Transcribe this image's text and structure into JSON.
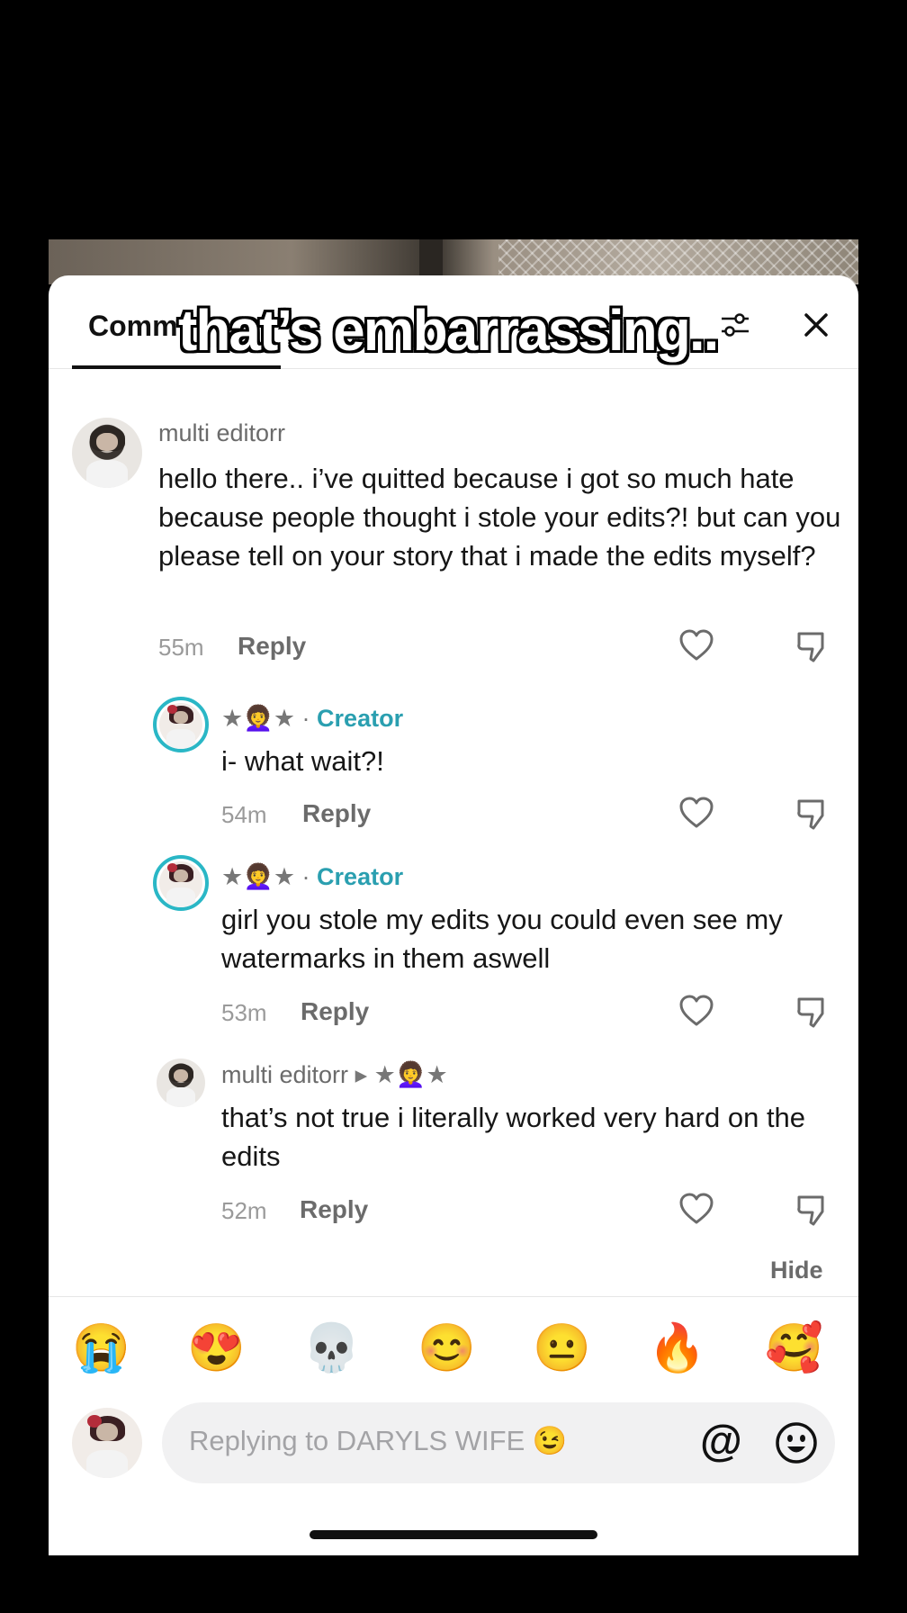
{
  "video": {
    "overlay_caption": "that’s embarrassing.."
  },
  "header": {
    "tab_label": "Comm"
  },
  "comments": [
    {
      "username": "multi editorr",
      "text": "hello there.. i’ve quitted because i got so much hate because people thought i stole your edits?! but can you please tell on your story that i made the edits myself?",
      "time": "55m",
      "reply_label": "Reply"
    },
    {
      "username_stars": "★👩‍🦱★ ·",
      "creator_tag": "Creator",
      "text": "i- what wait?!",
      "time": "54m",
      "reply_label": "Reply"
    },
    {
      "username_stars": "★👩‍🦱★ ·",
      "creator_tag": "Creator",
      "text": "girl you stole my edits you could even see my watermarks in them aswell",
      "time": "53m",
      "reply_label": "Reply"
    },
    {
      "username": "multi editorr",
      "reply_to": "▸ ★👩‍🦱★",
      "text": "that’s not true i literally worked very hard on the edits",
      "time": "52m",
      "reply_label": "Reply"
    }
  ],
  "hide_label": "Hide",
  "emoji_bar": [
    "😭",
    "😍",
    "💀",
    "😊",
    "😐",
    "🔥",
    "🥰"
  ],
  "composer": {
    "placeholder": "Replying to DARYLS WIFE 😉"
  },
  "icons": {
    "filter": "filter-icon",
    "close": "close-icon",
    "heart": "heart-icon",
    "dislike": "dislike-icon",
    "mention": "at-icon",
    "emoji": "smile-icon"
  },
  "colors": {
    "creator_accent": "#2a9fb0",
    "ring": "#2ab7c6"
  }
}
